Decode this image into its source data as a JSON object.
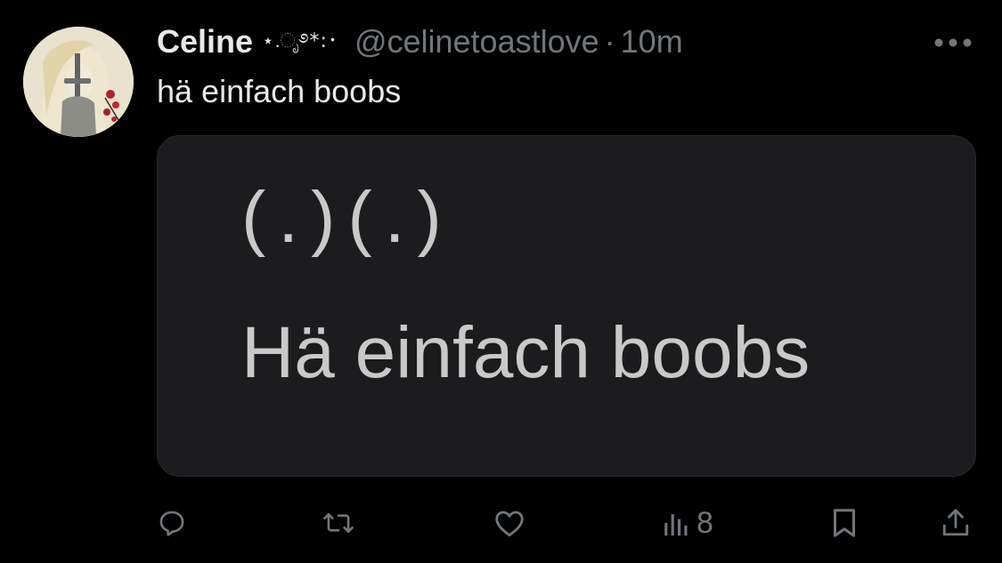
{
  "tweet": {
    "author": {
      "display_name": "Celine",
      "name_decoration": "⋆.ೃ࿔*:･",
      "handle": "@celinetoastlove",
      "avatar_icon": "illustrated-knight-avatar"
    },
    "separator": "·",
    "timestamp": "10m",
    "text": "hä einfach boobs",
    "media": {
      "line1": "(.)(.)",
      "line2": "Hä einfach boobs"
    },
    "actions": {
      "reply_icon": "reply-icon",
      "retweet_icon": "retweet-icon",
      "like_icon": "heart-icon",
      "views_icon": "views-icon",
      "views_count": "8",
      "bookmark_icon": "bookmark-icon",
      "share_icon": "share-icon"
    },
    "more_icon": "more-icon"
  },
  "colors": {
    "background": "#000000",
    "text_primary": "#e7e9ea",
    "text_secondary": "#71767b",
    "media_background": "#1c1c1f"
  }
}
